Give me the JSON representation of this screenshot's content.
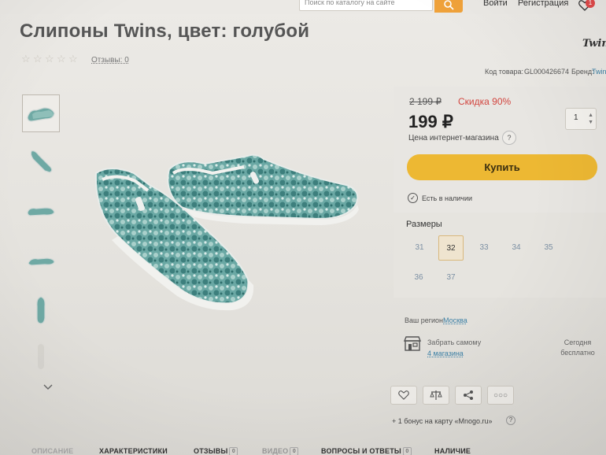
{
  "header": {
    "search_placeholder": "Поиск по каталогу на сайте",
    "login": "Войти",
    "register": "Регистрация",
    "wishlist_count": "1"
  },
  "product": {
    "title": "Слипоны Twins, цвет: голубой",
    "brand_logo": "Twins",
    "reviews_link": "Отзывы: 0",
    "rating": 0,
    "max_rating": 5,
    "code_label": "Код товара:",
    "code_value": "GL000426674",
    "brand_label": "Бренд:",
    "brand_value": "Twins"
  },
  "buy": {
    "old_price": "2 199 ₽",
    "discount": "Скидка 90%",
    "price": "199 ₽",
    "quantity": "1",
    "price_note": "Цена интернет-магазина",
    "help": "?",
    "buy_label": "Купить",
    "stock_text": "Есть в наличии"
  },
  "sizes": {
    "label": "Размеры",
    "items": [
      "31",
      "32",
      "33",
      "34",
      "35",
      "36",
      "37"
    ],
    "selected": "32"
  },
  "delivery": {
    "region_label": "Ваш регион:",
    "region": "Москва",
    "pickup_label": "Забрать самому",
    "pickup_stores": "4 магазина",
    "pickup_when_1": "Сегодня",
    "pickup_when_2": "бесплатно"
  },
  "bonus": {
    "text": "+ 1 бонус на карту «Mnogo.ru»",
    "help": "?"
  },
  "tabs": [
    {
      "label": "ОПИСАНИЕ"
    },
    {
      "label": "ХАРАКТЕРИСТИКИ"
    },
    {
      "label": "ОТЗЫВЫ",
      "count": "0"
    },
    {
      "label": "ВИДЕО",
      "count": "0"
    },
    {
      "label": "ВОПРОСЫ И ОТВЕТЫ",
      "count": "0"
    },
    {
      "label": "НАЛИЧИЕ"
    }
  ],
  "colors": {
    "accent_button": "#edb833",
    "discount_red": "#d2453f",
    "link_blue": "#3a7fa5",
    "shoe_teal": "#4f9a98"
  },
  "icons": [
    "search-icon",
    "heart-icon",
    "star-icon",
    "chevron-down-icon",
    "store-icon",
    "compare-icon",
    "share-icon",
    "more-icon",
    "check-circle-icon"
  ]
}
